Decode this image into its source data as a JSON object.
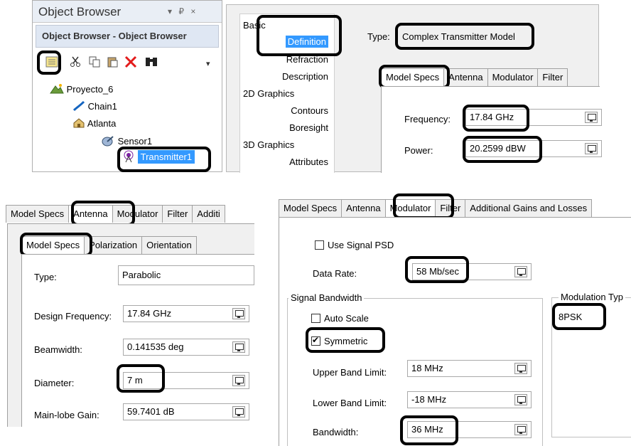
{
  "object_browser": {
    "pane_title": "Object Browser",
    "pane_controls": "▾ ₽ ×",
    "header": "Object Browser - Object Browser",
    "toolbar_more": "▾",
    "tree": [
      "Proyecto_6",
      "Chain1",
      "Atlanta",
      "Sensor1",
      "Transmitter1"
    ]
  },
  "props_nav": {
    "items": [
      {
        "label": "Basic",
        "indent": 0
      },
      {
        "label": "Definition",
        "indent": 1,
        "selected": true
      },
      {
        "label": "Refraction",
        "indent": 1
      },
      {
        "label": "Description",
        "indent": 1
      },
      {
        "label": "2D Graphics",
        "indent": 0
      },
      {
        "label": "Contours",
        "indent": 1
      },
      {
        "label": "Boresight",
        "indent": 1
      },
      {
        "label": "3D Graphics",
        "indent": 0
      },
      {
        "label": "Attributes",
        "indent": 1
      }
    ]
  },
  "definition": {
    "type_label": "Type:",
    "type_value": "Complex Transmitter Model",
    "tabs": [
      "Model Specs",
      "Antenna",
      "Modulator",
      "Filter"
    ],
    "frequency_label": "Frequency:",
    "frequency_value": "17.84 GHz",
    "power_label": "Power:",
    "power_value": "20.2599 dBW"
  },
  "antenna": {
    "tabs": [
      "Model Specs",
      "Antenna",
      "Modulator",
      "Filter",
      "Additi"
    ],
    "subtabs": [
      "Model Specs",
      "Polarization",
      "Orientation"
    ],
    "type_label": "Type:",
    "type_value": "Parabolic",
    "design_freq_label": "Design Frequency:",
    "design_freq_value": "17.84 GHz",
    "beamwidth_label": "Beamwidth:",
    "beamwidth_value": "0.141535 deg",
    "diameter_label": "Diameter:",
    "diameter_value": "7 m",
    "mainlobe_label": "Main-lobe Gain:",
    "mainlobe_value": "59.7401 dB"
  },
  "modulator": {
    "tabs": [
      "Model Specs",
      "Antenna",
      "Modulator",
      "Filter",
      "Additional Gains and Losses"
    ],
    "use_psd_label": "Use Signal PSD",
    "data_rate_label": "Data Rate:",
    "data_rate_value": "58 Mb/sec",
    "signal_bw_title": "Signal Bandwidth",
    "auto_scale_label": "Auto Scale",
    "symmetric_label": "Symmetric",
    "symmetric_check": "✔",
    "upper_label": "Upper Band Limit:",
    "upper_value": "18 MHz",
    "lower_label": "Lower Band Limit:",
    "lower_value": "-18 MHz",
    "bandwidth_label": "Bandwidth:",
    "bandwidth_value": "36 MHz",
    "mod_type_title": "Modulation Typ",
    "mod_type_value": "8PSK"
  }
}
